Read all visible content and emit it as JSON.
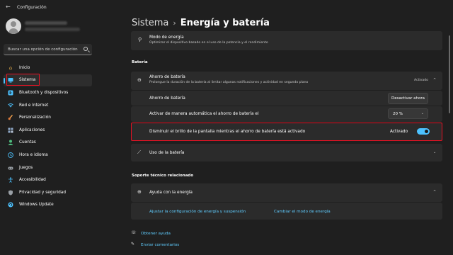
{
  "window": {
    "title": "Configuración"
  },
  "sidebar": {
    "search_placeholder": "Buscar una opción de configuración",
    "items": [
      {
        "label": "Inicio",
        "icon": "home-icon",
        "color": "#e8b04b"
      },
      {
        "label": "Sistema",
        "icon": "system-icon",
        "color": "#4cc2ff"
      },
      {
        "label": "Bluetooth y dispositivos",
        "icon": "bluetooth-icon",
        "color": "#4cc2ff"
      },
      {
        "label": "Red e Internet",
        "icon": "wifi-icon",
        "color": "#4cc2ff"
      },
      {
        "label": "Personalización",
        "icon": "brush-icon",
        "color": "#f0a04b"
      },
      {
        "label": "Aplicaciones",
        "icon": "apps-icon",
        "color": "#8fa8c8"
      },
      {
        "label": "Cuentas",
        "icon": "account-icon",
        "color": "#4fbf7f"
      },
      {
        "label": "Hora e idioma",
        "icon": "globe-clock-icon",
        "color": "#4cc2ff"
      },
      {
        "label": "Juegos",
        "icon": "gamepad-icon",
        "color": "#9aa0a6"
      },
      {
        "label": "Accesibilidad",
        "icon": "accessibility-icon",
        "color": "#4cc2ff"
      },
      {
        "label": "Privacidad y seguridad",
        "icon": "shield-icon",
        "color": "#9aa0a6"
      },
      {
        "label": "Windows Update",
        "icon": "update-icon",
        "color": "#4cc2ff"
      }
    ]
  },
  "breadcrumb": {
    "parent": "Sistema",
    "current": "Energía y batería"
  },
  "power_mode": {
    "title": "Modo de energía",
    "subtitle": "Optimizar el dispositivo basado en el uso de la potencia y el rendimiento"
  },
  "battery_section": {
    "heading": "Batería",
    "saver": {
      "title": "Ahorro de batería",
      "subtitle": "Prolongue la duración de la batería al limitar algunas notificaciones y actividad en segundo plano",
      "status": "Activado"
    },
    "rows": {
      "saver_now_label": "Ahorro de batería",
      "saver_now_button": "Desactivar ahora",
      "auto_label": "Activar de manera automática el ahorro de batería el",
      "auto_value": "20 %",
      "dim_label": "Disminuir el brillo de la pantalla mientras el ahorro de batería está activado",
      "dim_state": "Activado"
    },
    "usage": {
      "title": "Uso de la batería"
    }
  },
  "support": {
    "heading": "Soporte técnico relacionado",
    "help": {
      "title": "Ayuda con la energía"
    },
    "links": [
      "Ajustar la configuración de energía y suspensión",
      "Cambiar el modo de energía"
    ]
  },
  "footer": {
    "get_help": "Obtener ayuda",
    "feedback": "Enviar comentarios"
  },
  "colors": {
    "accent": "#4cc2ff",
    "highlight": "#e81123"
  }
}
